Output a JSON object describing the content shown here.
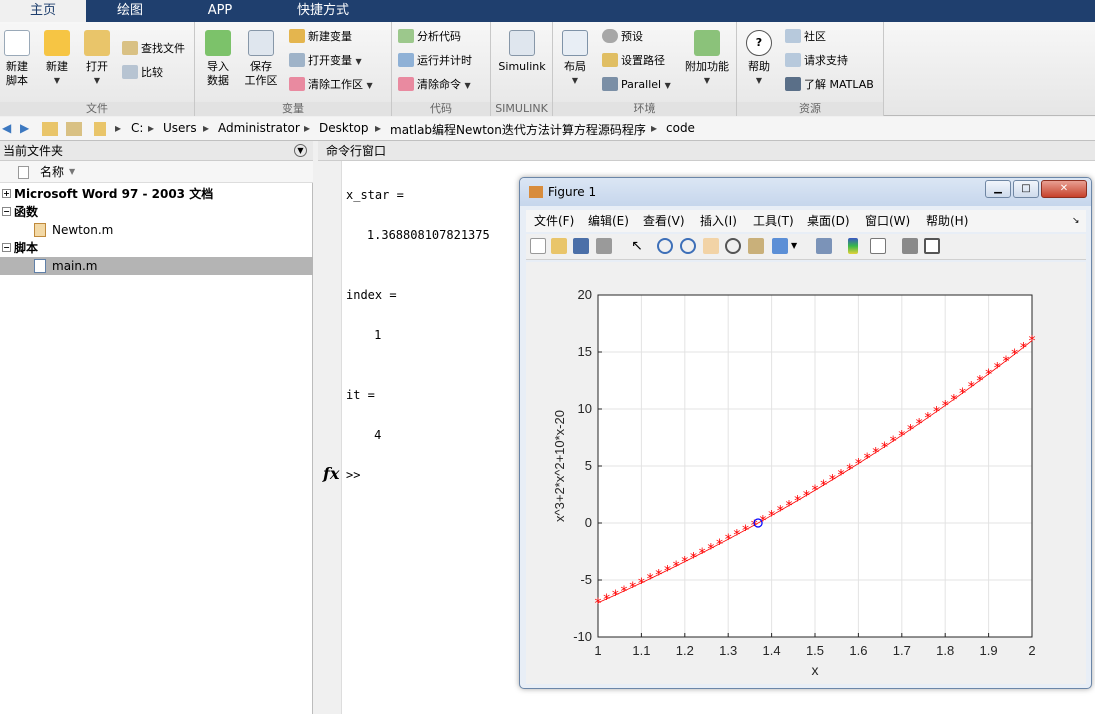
{
  "tabs": [
    {
      "label": "主页",
      "active": true
    },
    {
      "label": "绘图",
      "active": false
    },
    {
      "label": "APP",
      "active": false
    },
    {
      "label": "快捷方式",
      "active": false
    }
  ],
  "ribbon": {
    "file": {
      "title": "文件",
      "new_script": "新建\n脚本",
      "new": "新建",
      "open": "打开",
      "find_files": "查找文件",
      "compare": "比较"
    },
    "variable": {
      "title": "变量",
      "import_data": "导入\n数据",
      "save_workspace": "保存\n工作区",
      "new_variable": "新建变量",
      "open_variable": "打开变量",
      "clear_workspace": "清除工作区"
    },
    "code": {
      "title": "代码",
      "analyze_code": "分析代码",
      "run_and_time": "运行并计时",
      "clear_commands": "清除命令"
    },
    "simulink": {
      "title": "SIMULINK",
      "simulink": "Simulink"
    },
    "environment": {
      "title": "环境",
      "layout": "布局",
      "preferences": "预设",
      "set_path": "设置路径",
      "parallel": "Parallel",
      "addons": "附加功能"
    },
    "resources": {
      "title": "资源",
      "help": "帮助",
      "community": "社区",
      "request_support": "请求支持",
      "learn_matlab": "了解 MATLAB"
    }
  },
  "address": {
    "crumbs": [
      "C:",
      "Users",
      "Administrator",
      "Desktop",
      "matlab编程Newton迭代方法计算方程源码程序",
      "code"
    ]
  },
  "current_folder": {
    "title": "当前文件夹",
    "col_name": "名称",
    "groups": [
      {
        "label": "Microsoft Word 97 - 2003 文档",
        "files": []
      },
      {
        "label": "函数",
        "files": [
          "Newton.m"
        ]
      },
      {
        "label": "脚本",
        "files": [
          "main.m"
        ]
      }
    ],
    "selected": "main.m"
  },
  "command_window": {
    "title": "命令行窗口",
    "lines": [
      {
        "text": "x_star ="
      },
      {
        "text": "    1.368808107821375"
      },
      {
        "text": "index ="
      },
      {
        "text": "     1"
      },
      {
        "text": "it ="
      },
      {
        "text": "     4"
      }
    ],
    "fx": "fx",
    "prompt": ">>"
  },
  "figure": {
    "title": "Figure 1",
    "menus": [
      "文件(F)",
      "编辑(E)",
      "查看(V)",
      "插入(I)",
      "工具(T)",
      "桌面(D)",
      "窗口(W)",
      "帮助(H)"
    ]
  },
  "chart_data": {
    "type": "scatter",
    "title": "",
    "xlabel": "x",
    "ylabel": "x^3+2*x^2+10*x-20",
    "xlim": [
      1,
      2
    ],
    "ylim": [
      -10,
      20
    ],
    "xticks": [
      1,
      1.1,
      1.2,
      1.3,
      1.4,
      1.5,
      1.6,
      1.7,
      1.8,
      1.9,
      2
    ],
    "yticks": [
      -10,
      -5,
      0,
      5,
      10,
      15,
      20
    ],
    "grid": true,
    "series": [
      {
        "marker": "*",
        "color": "#ff0000",
        "function": "x^3+2*x^2+10*x-20",
        "x_start": 1,
        "x_end": 2,
        "x_step": 0.02
      },
      {
        "marker": "o",
        "color": "#0000ff",
        "points": [
          [
            1.368808107821375,
            0
          ]
        ]
      }
    ]
  }
}
